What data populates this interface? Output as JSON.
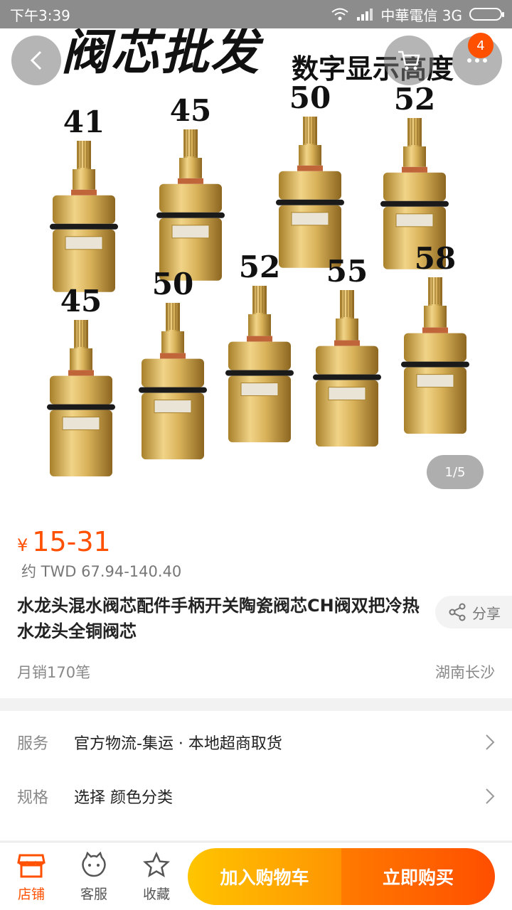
{
  "status_bar": {
    "time": "下午3:39",
    "carrier": "中華電信 3G"
  },
  "hero": {
    "banner_left": "阀芯批发",
    "banner_right": "数字显示高度",
    "valve_sizes_row1": [
      "41",
      "45",
      "50",
      "52"
    ],
    "valve_sizes_row2": [
      "45",
      "50",
      "52",
      "55",
      "58"
    ],
    "cart_badge": "4",
    "pager": "1/5"
  },
  "product": {
    "currency": "¥",
    "price": "15-31",
    "price_twd": "约 TWD 67.94-140.40",
    "title": "水龙头混水阀芯配件手柄开关陶瓷阀芯CH阀双把冷热水龙头全铜阀芯",
    "share_label": "分享",
    "monthly_sales": "月销170笔",
    "location": "湖南长沙"
  },
  "options": {
    "service_label": "服务",
    "service_value": "官方物流-集运 · 本地超商取货",
    "spec_label": "规格",
    "spec_value": "选择 颜色分类"
  },
  "bottom_bar": {
    "shop_label": "店铺",
    "service_label": "客服",
    "favorite_label": "收藏",
    "add_to_cart": "加入购物车",
    "buy_now": "立即购买"
  },
  "colors": {
    "accent": "#ff5000",
    "cart_gradient_start": "#ffc500",
    "buy_gradient_end": "#ff4e00"
  }
}
